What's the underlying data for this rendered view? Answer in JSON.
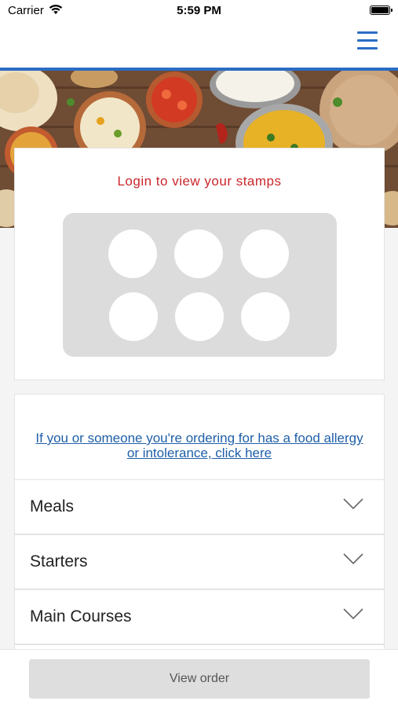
{
  "status_bar": {
    "carrier": "Carrier",
    "time": "5:59 PM"
  },
  "header": {
    "menu_icon": "hamburger-menu-icon",
    "accent_color": "#2b6cc4"
  },
  "stamps": {
    "title": "Login to view your stamps",
    "title_color": "#c9262b",
    "stamp_count": 6
  },
  "allergy": {
    "link_text": "If you or someone you're ordering for has a food allergy or intolerance, click here",
    "link_color": "#1f5fa8"
  },
  "categories": [
    {
      "label": "Meals"
    },
    {
      "label": "Starters"
    },
    {
      "label": "Main Courses"
    }
  ],
  "footer": {
    "view_order_label": "View order"
  }
}
